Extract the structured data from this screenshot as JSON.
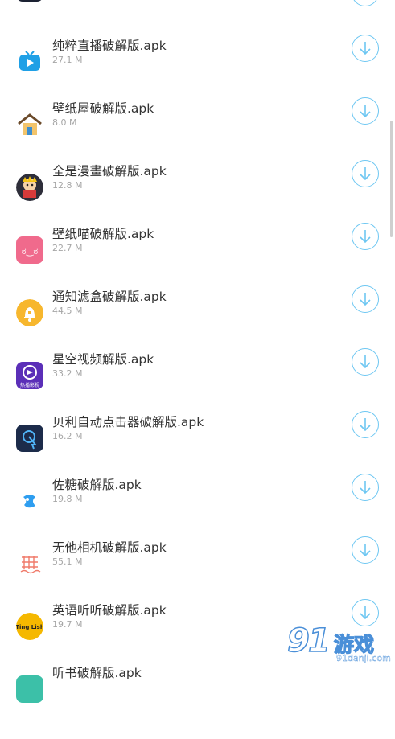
{
  "apps": [
    {
      "name": "纯粹直播破解版.apk",
      "size": "27.1 M",
      "icon": "tv-icon"
    },
    {
      "name": "壁纸屋破解版.apk",
      "size": "8.0 M",
      "icon": "house-icon"
    },
    {
      "name": "全是漫畫破解版.apk",
      "size": "12.8 M",
      "icon": "manga-reader-icon"
    },
    {
      "name": "壁纸喵破解版.apk",
      "size": "22.7 M",
      "icon": "cat-face-icon"
    },
    {
      "name": "通知滤盒破解版.apk",
      "size": "44.5 M",
      "icon": "bell-icon"
    },
    {
      "name": "星空视频解版.apk",
      "size": "33.2 M",
      "icon": "starry-video-icon"
    },
    {
      "name": "贝利自动点击器破解版.apk",
      "size": "16.2 M",
      "icon": "touch-click-icon"
    },
    {
      "name": "佐糖破解版.apk",
      "size": "19.8 M",
      "icon": "zuotang-icon"
    },
    {
      "name": "无他相机破解版.apk",
      "size": "55.1 M",
      "icon": "camera-grid-icon"
    },
    {
      "name": "英语听听破解版.apk",
      "size": "19.7 M",
      "icon": "tingting-icon"
    },
    {
      "name": "听书破解版.apk",
      "size": "",
      "icon": "partial-icon"
    }
  ],
  "icon_labels": {
    "starry": "热播影视",
    "tingting": "Ting Lish",
    "cat_face": "ಠ‿ಠ"
  },
  "watermark": {
    "number": "91",
    "brand": "游戏",
    "url": "91danji.com"
  },
  "colors": {
    "accent": "#6ec7f2",
    "text": "#333333",
    "subtext": "#a6a6a6"
  }
}
